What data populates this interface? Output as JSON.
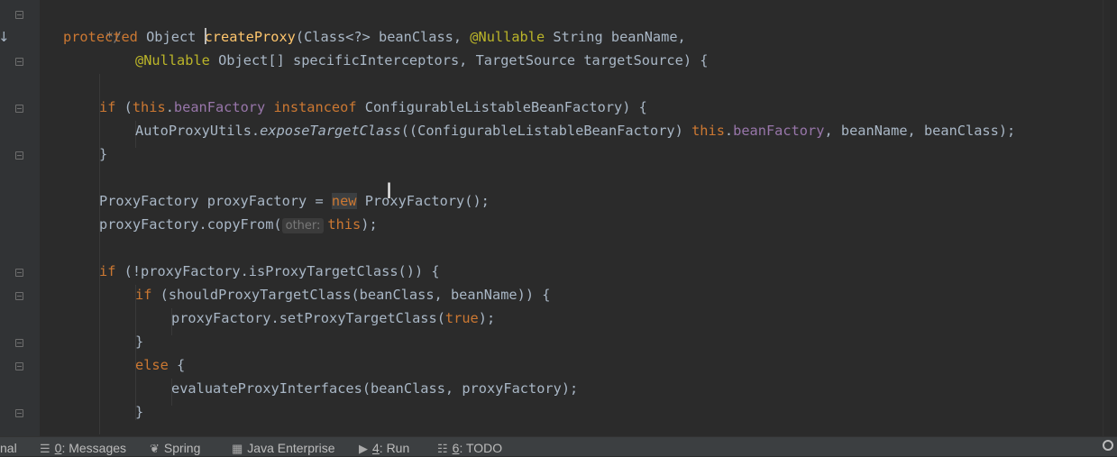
{
  "editor": {
    "lines": {
      "l1": {
        "comment": "*/"
      },
      "l2": {
        "mod": "protected",
        "t1": " Object ",
        "method": "createProxy",
        "t2": "(Class<?> beanClass, ",
        "ann": "@Nullable",
        "t3": " String beanName,"
      },
      "l3": {
        "ann": "@Nullable",
        "t1": " Object[] specificInterceptors, TargetSource targetSource) {"
      },
      "l5": {
        "kw_if": "if",
        "t1": " (",
        "kw_this": "this",
        "t2": ".",
        "field": "beanFactory",
        "t3": " ",
        "kw_instanceof": "instanceof",
        "t4": " ConfigurableListableBeanFactory) {"
      },
      "l6": {
        "t1": "AutoProxyUtils.",
        "call": "exposeTargetClass",
        "t2": "((ConfigurableListableBeanFactory) ",
        "kw_this": "this",
        "t3": ".",
        "field": "beanFactory",
        "t4": ", beanName, beanClass);"
      },
      "l7": {
        "t1": "}"
      },
      "l9": {
        "t1": "ProxyFactory proxyFactory = ",
        "kw_new": "new",
        "t2": " ProxyFactory();"
      },
      "l10": {
        "t1": "proxyFactory.copyFrom(",
        "hint": "other:",
        "kw_this": "this",
        "t2": ");"
      },
      "l12": {
        "kw_if": "if",
        "t1": " (!proxyFactory.isProxyTargetClass()) {"
      },
      "l13": {
        "kw_if": "if",
        "t1": " (shouldProxyTargetClass(beanClass, beanName)) {"
      },
      "l14": {
        "t1": "proxyFactory.setProxyTargetClass(",
        "kw_true": "true",
        "t2": ");"
      },
      "l15": {
        "t1": "}"
      },
      "l16": {
        "kw_else": "else",
        "t1": " {"
      },
      "l17": {
        "t1": "evaluateProxyInterfaces(beanClass, proxyFactory);"
      },
      "l18": {
        "t1": "}"
      }
    }
  },
  "statusbar": {
    "terminal_partial": "nal",
    "messages": {
      "num": "0",
      "label": ": Messages"
    },
    "spring": "Spring",
    "java_enterprise": "Java Enterprise",
    "run": {
      "num": "4",
      "label": ": Run"
    },
    "todo": {
      "num": "6",
      "label": ": TODO"
    }
  },
  "colors": {
    "background": "#2b2b2b",
    "keyword": "#cc7832",
    "annotation": "#bbb529",
    "field": "#9876aa",
    "method_declaration": "#ffc66d",
    "comment": "#808080",
    "default_text": "#a9b7c6",
    "statusbar": "#3c3f41"
  },
  "icons": [
    "fold-marker-icon",
    "gutter-arrow-icon",
    "messages-icon",
    "spring-leaf-icon",
    "java-enterprise-icon",
    "run-icon",
    "todo-icon",
    "search-icon"
  ]
}
